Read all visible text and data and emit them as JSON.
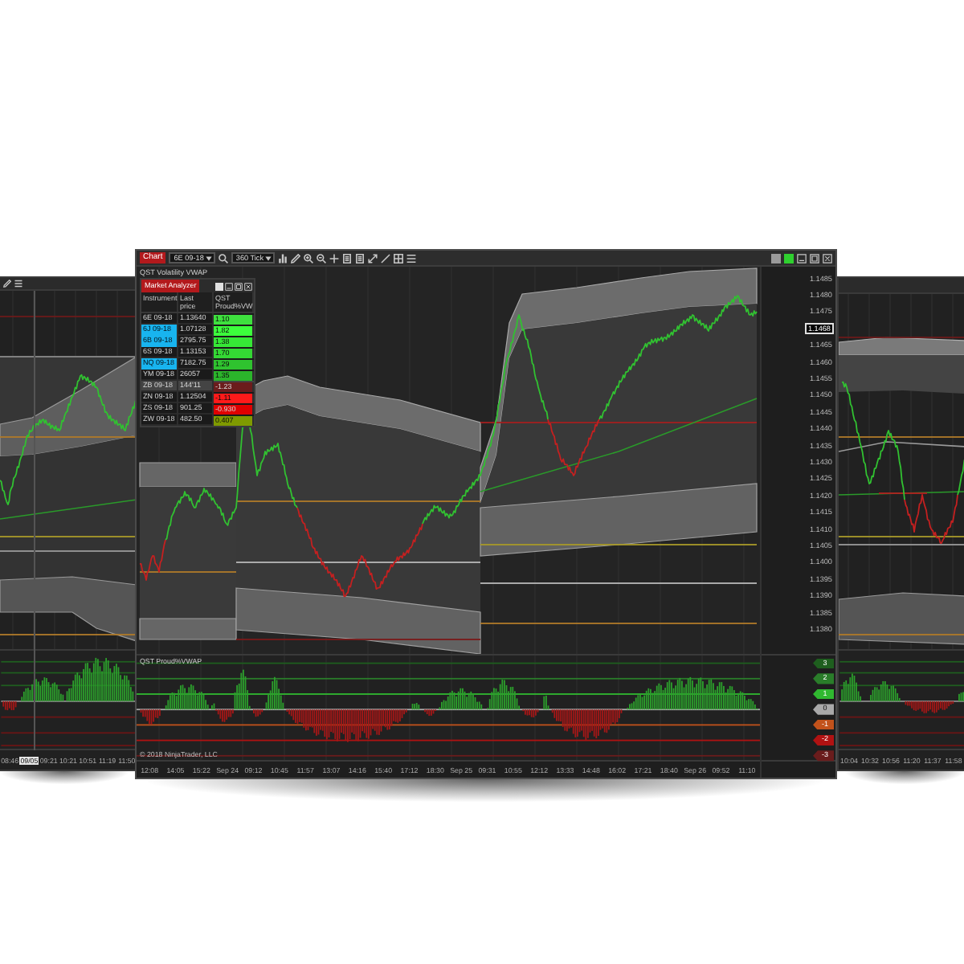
{
  "main_window": {
    "toolbar": {
      "title": "Chart",
      "instrument": "6E 09-18",
      "interval": "360 Tick"
    },
    "chart_title": "QST Volatility VWAP",
    "market_analyzer": {
      "title": "Market Analyzer",
      "columns": [
        "Instrument",
        "Last price",
        "QST Proud%VW"
      ],
      "rows": [
        {
          "instrument": "6E 09-18",
          "last_price": "1.13640",
          "value": "1.10",
          "flagged": false,
          "selected": false,
          "color": "#3ee03e"
        },
        {
          "instrument": "6J 09-18",
          "last_price": "1.07128",
          "value": "1.82",
          "flagged": true,
          "selected": false,
          "color": "#3cff3c"
        },
        {
          "instrument": "6B 09-18",
          "last_price": "2795.75",
          "value": "1.38",
          "flagged": true,
          "selected": false,
          "color": "#36e836"
        },
        {
          "instrument": "6S 09-18",
          "last_price": "1.13153",
          "value": "1.70",
          "flagged": false,
          "selected": false,
          "color": "#34d834"
        },
        {
          "instrument": "NQ 09-18",
          "last_price": "7182.75",
          "value": "1.29",
          "flagged": true,
          "selected": false,
          "color": "#2fc32f"
        },
        {
          "instrument": "YM 09-18",
          "last_price": "26057",
          "value": "1.35",
          "flagged": false,
          "selected": false,
          "color": "#2bb52b"
        },
        {
          "instrument": "ZB 09-18",
          "last_price": "144'11",
          "value": "-1.23",
          "flagged": false,
          "selected": true,
          "color": "#6b1c1c"
        },
        {
          "instrument": "ZN 09-18",
          "last_price": "1.12504",
          "value": "-1.11",
          "flagged": false,
          "selected": false,
          "color": "#ff1a1a"
        },
        {
          "instrument": "ZS 09-18",
          "last_price": "901.25",
          "value": "-0.930",
          "flagged": false,
          "selected": false,
          "color": "#e00000"
        },
        {
          "instrument": "ZW 09-18",
          "last_price": "482.50",
          "value": "0.407",
          "flagged": false,
          "selected": false,
          "color": "#7f9a00"
        }
      ]
    },
    "price_axis": [
      {
        "label": "1.1485",
        "current": false
      },
      {
        "label": "1.1480",
        "current": false
      },
      {
        "label": "1.1475",
        "current": false
      },
      {
        "label": "1.1468",
        "current": true
      },
      {
        "label": "1.1465",
        "current": false
      },
      {
        "label": "1.1460",
        "current": false
      },
      {
        "label": "1.1455",
        "current": false
      },
      {
        "label": "1.1450",
        "current": false
      },
      {
        "label": "1.1445",
        "current": false
      },
      {
        "label": "1.1440",
        "current": false
      },
      {
        "label": "1.1435",
        "current": false
      },
      {
        "label": "1.1430",
        "current": false
      },
      {
        "label": "1.1425",
        "current": false
      },
      {
        "label": "1.1420",
        "current": false
      },
      {
        "label": "1.1415",
        "current": false
      },
      {
        "label": "1.1410",
        "current": false
      },
      {
        "label": "1.1405",
        "current": false
      },
      {
        "label": "1.1400",
        "current": false
      },
      {
        "label": "1.1395",
        "current": false
      },
      {
        "label": "1.1390",
        "current": false
      },
      {
        "label": "1.1385",
        "current": false
      },
      {
        "label": "1.1380",
        "current": false
      }
    ],
    "indicator": {
      "title": "QST Proud%VWAP",
      "copyright": "© 2018 NinjaTrader, LLC",
      "levels": [
        {
          "label": "3",
          "color": "#1e5e1e"
        },
        {
          "label": "2",
          "color": "#2a7d2a"
        },
        {
          "label": "1",
          "color": "#30b830"
        },
        {
          "label": "0",
          "color": "#a9a9a9"
        },
        {
          "label": "-1",
          "color": "#c2521b"
        },
        {
          "label": "-2",
          "color": "#b01212"
        },
        {
          "label": "-3",
          "color": "#6a1c1c"
        }
      ]
    },
    "time_axis": [
      "12:08",
      "14:05",
      "15:22",
      "Sep 24",
      "09:12",
      "10:45",
      "11:57",
      "13:07",
      "14:16",
      "15:40",
      "17:12",
      "18:30",
      "Sep 25",
      "09:31",
      "10:55",
      "12:12",
      "13:33",
      "14:48",
      "16:02",
      "17:21",
      "18:40",
      "Sep 26",
      "09:52",
      "11:10"
    ]
  },
  "left_window": {
    "time_axis": [
      {
        "label": "08:46",
        "current": false
      },
      {
        "label": "09/05",
        "current": true
      },
      {
        "label": "09:21",
        "current": false
      },
      {
        "label": "10:21",
        "current": false
      },
      {
        "label": "10:51",
        "current": false
      },
      {
        "label": "11:19",
        "current": false
      },
      {
        "label": "11:50",
        "current": false
      }
    ]
  },
  "right_window": {
    "time_axis": [
      "10:04",
      "10:32",
      "10:56",
      "11:20",
      "11:37",
      "11:58"
    ]
  }
}
